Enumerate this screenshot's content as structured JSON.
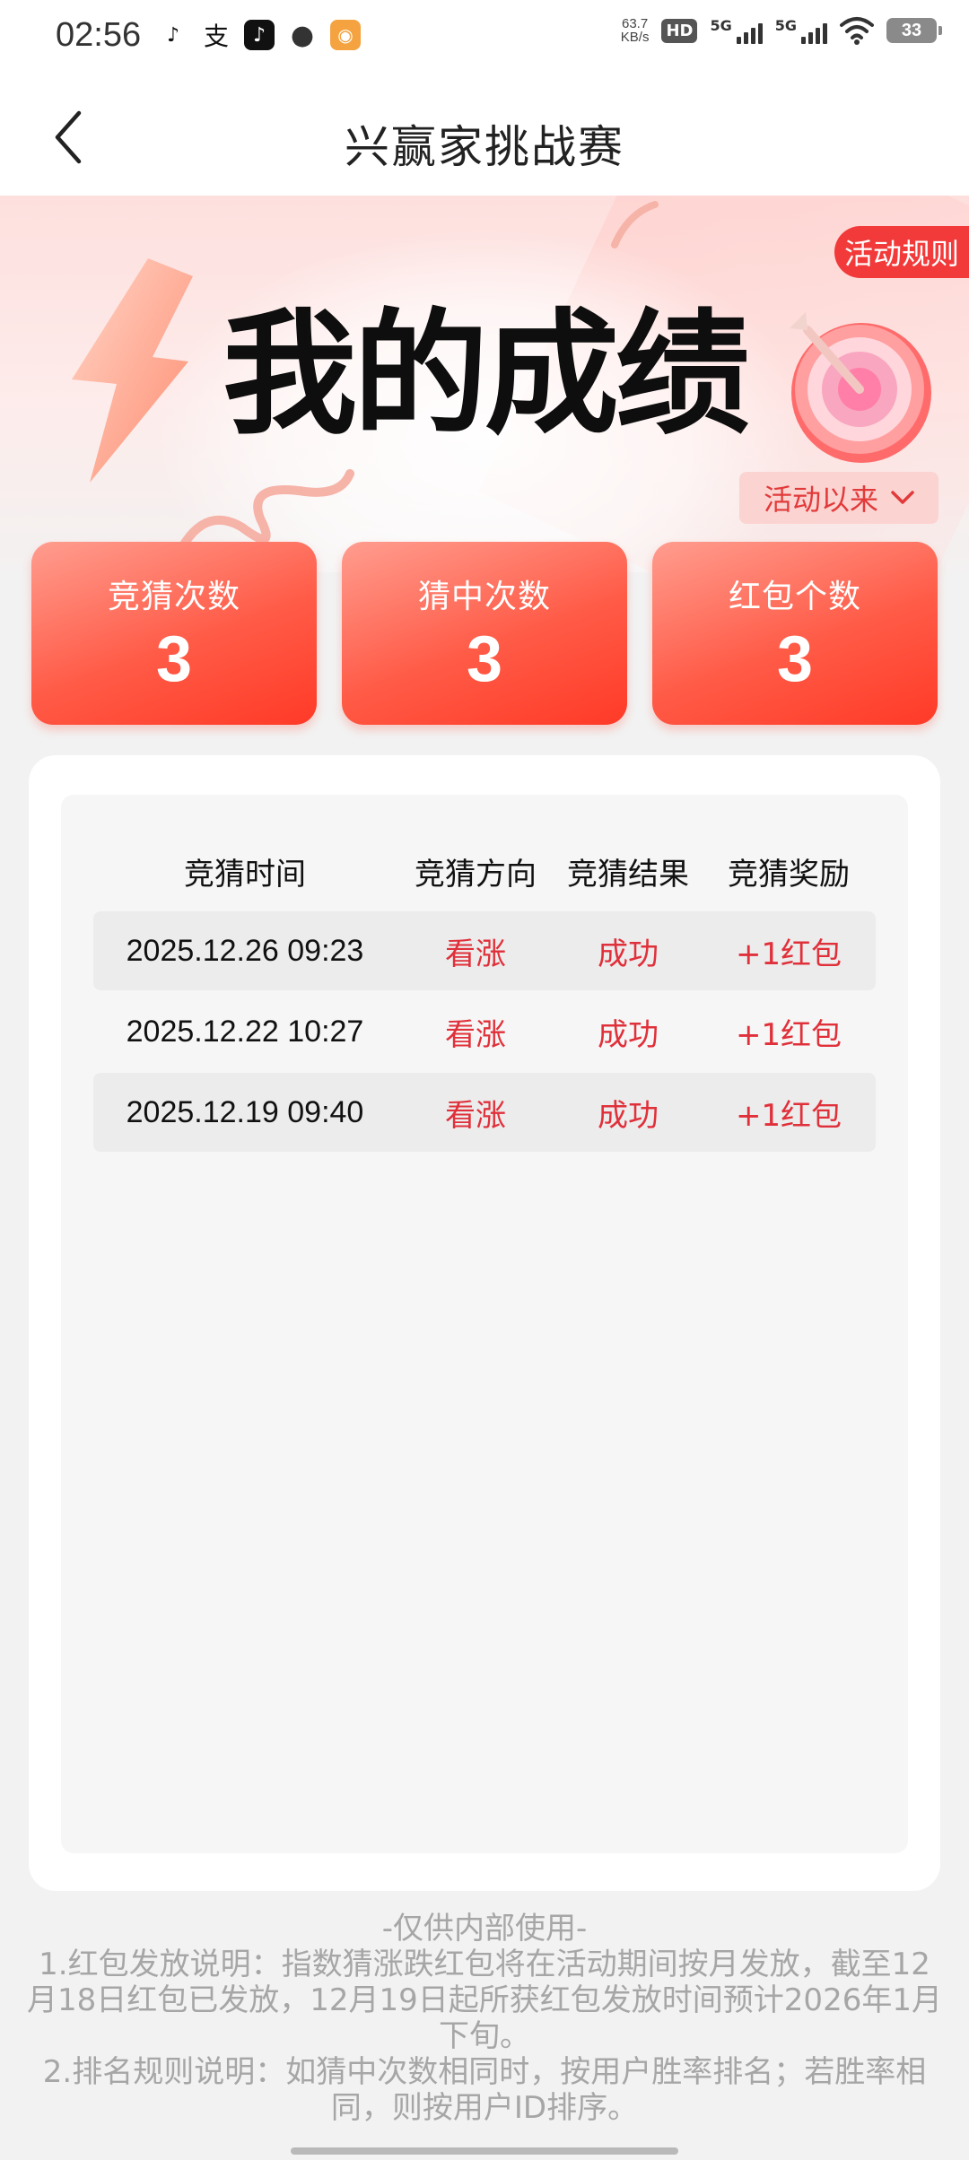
{
  "status_bar": {
    "time": "02:56",
    "net_speed_value": "63.7",
    "net_speed_unit": "KB/s",
    "hd_label": "HD",
    "sim1_label": "5G",
    "sim2_label": "5G",
    "battery": "33",
    "app_icons": [
      "tiktok-lite-icon",
      "alipay-icon",
      "douyin-icon",
      "message-icon",
      "game-icon"
    ]
  },
  "header": {
    "title": "兴赢家挑战赛",
    "back_icon": "chevron-left-icon"
  },
  "banner": {
    "title": "我的成绩",
    "rules_label": "活动规则",
    "period_label": "活动以来"
  },
  "stats": [
    {
      "label": "竞猜次数",
      "value": "3"
    },
    {
      "label": "猜中次数",
      "value": "3"
    },
    {
      "label": "红包个数",
      "value": "3"
    }
  ],
  "table": {
    "headers": [
      "竞猜时间",
      "竞猜方向",
      "竞猜结果",
      "竞猜奖励"
    ],
    "rows": [
      {
        "time": "2025.12.26 09:23",
        "direction": "看涨",
        "result": "成功",
        "reward": "+1红包"
      },
      {
        "time": "2025.12.22 10:27",
        "direction": "看涨",
        "result": "成功",
        "reward": "+1红包"
      },
      {
        "time": "2025.12.19 09:40",
        "direction": "看涨",
        "result": "成功",
        "reward": "+1红包"
      }
    ]
  },
  "footer": {
    "internal": "-仅供内部使用-",
    "note1": "1.红包发放说明：指数猜涨跌红包将在活动期间按月发放，截至12月18日红包已发放，12月19日起所获红包发放时间预计2026年1月下旬。",
    "note2": "2.排名规则说明：如猜中次数相同时，按用户胜率排名；若胜率相同，则按用户ID排序。"
  },
  "colors": {
    "accent_red": "#f23a3a",
    "card_gradient_start": "#ff9d8f",
    "card_gradient_end": "#ff3a27",
    "reward_text": "#e0303a"
  }
}
